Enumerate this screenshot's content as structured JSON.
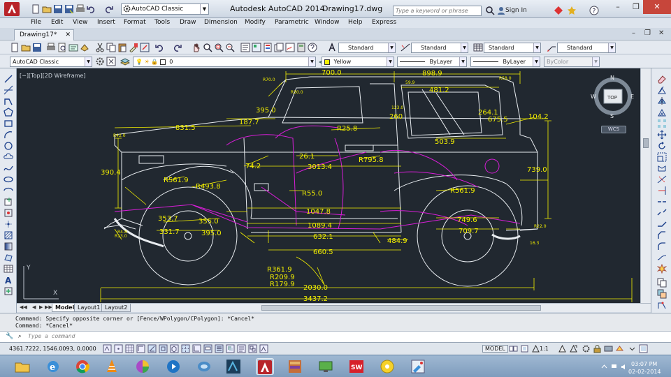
{
  "titlebar": {
    "workspace": "AutoCAD Classic",
    "app_title": "Autodesk AutoCAD 2014",
    "drawing_title": "Drawing17.dwg",
    "search_placeholder": "Type a keyword or phrase",
    "sign_in": "Sign In",
    "help": "?"
  },
  "menu": [
    "File",
    "Edit",
    "View",
    "Insert",
    "Format",
    "Tools",
    "Draw",
    "Dimension",
    "Modify",
    "Parametric",
    "Window",
    "Help",
    "Express"
  ],
  "doc_tab": {
    "label": "Drawing17*"
  },
  "styles": {
    "text_style": "Standard",
    "dim_style": "Standard",
    "table_style": "Standard",
    "multileader_style": "Standard"
  },
  "workspace_combo2": "AutoCAD Classic",
  "layer": "0",
  "properties": {
    "color": "Yellow",
    "color_hex": "#f4f000",
    "linetype": "ByLayer",
    "lineweight": "ByLayer",
    "plotstyle": "ByColor"
  },
  "viewport_label": "[−][Top][2D Wireframe]",
  "viewcube": {
    "top": "TOP",
    "n": "N",
    "s": "S",
    "e": "E",
    "w": "W",
    "wcs": "WCS"
  },
  "dimensions": {
    "d700": "700.0",
    "d898": "898.9",
    "d481": "481.2",
    "d395": "395.0",
    "d187": "187.7",
    "d831": "831.5",
    "d390": "390.4",
    "d264": "264.1",
    "d104": "104.2",
    "d675": "675.5",
    "d503": "503.9",
    "d260": "260",
    "dR258": "R25.8",
    "dR7958": "R795.8",
    "d261": "26.1",
    "d3013": "3013.4",
    "d742": "74.2",
    "dR5619a": "R561.9",
    "dR4938": "R493.8",
    "dR550": "R55.0",
    "dR5619b": "R561.9",
    "d739": "739.0",
    "d1047": "1047.8",
    "d1089": "1089.4",
    "d353": "353.7",
    "d355": "355.0",
    "d331": "331.7",
    "d395b": "395.0",
    "d632": "632.1",
    "d484": "484.9",
    "d749": "749.6",
    "d709": "709.7",
    "d660": "660.5",
    "dR3619": "R361.9",
    "dR2099": "R209.9",
    "dR1799": "R179.9",
    "d2030": "2030.0",
    "d3437": "3437.2",
    "sR700": "R70.0",
    "sR300": "R30.0",
    "sR580": "R58.0",
    "sR420": "R42.0",
    "sR220": "R22.0",
    "sR130": "R13.0",
    "sR4": "R4.8",
    "s599": "59.9",
    "s1230": "123.0",
    "s163": "16.3"
  },
  "layouts": [
    "Model",
    "Layout1",
    "Layout2"
  ],
  "command": {
    "line1": "Command: Specify opposite corner or [Fence/WPolygon/CPolygon]: *Cancel*",
    "line2": "Command: *Cancel*",
    "placeholder": "Type a command"
  },
  "status": {
    "coords": "4361.7222, 1546.0093, 0.0000",
    "model": "MODEL",
    "scale": "1:1"
  },
  "clock": {
    "time": "03:07 PM",
    "date": "02-02-2014"
  }
}
